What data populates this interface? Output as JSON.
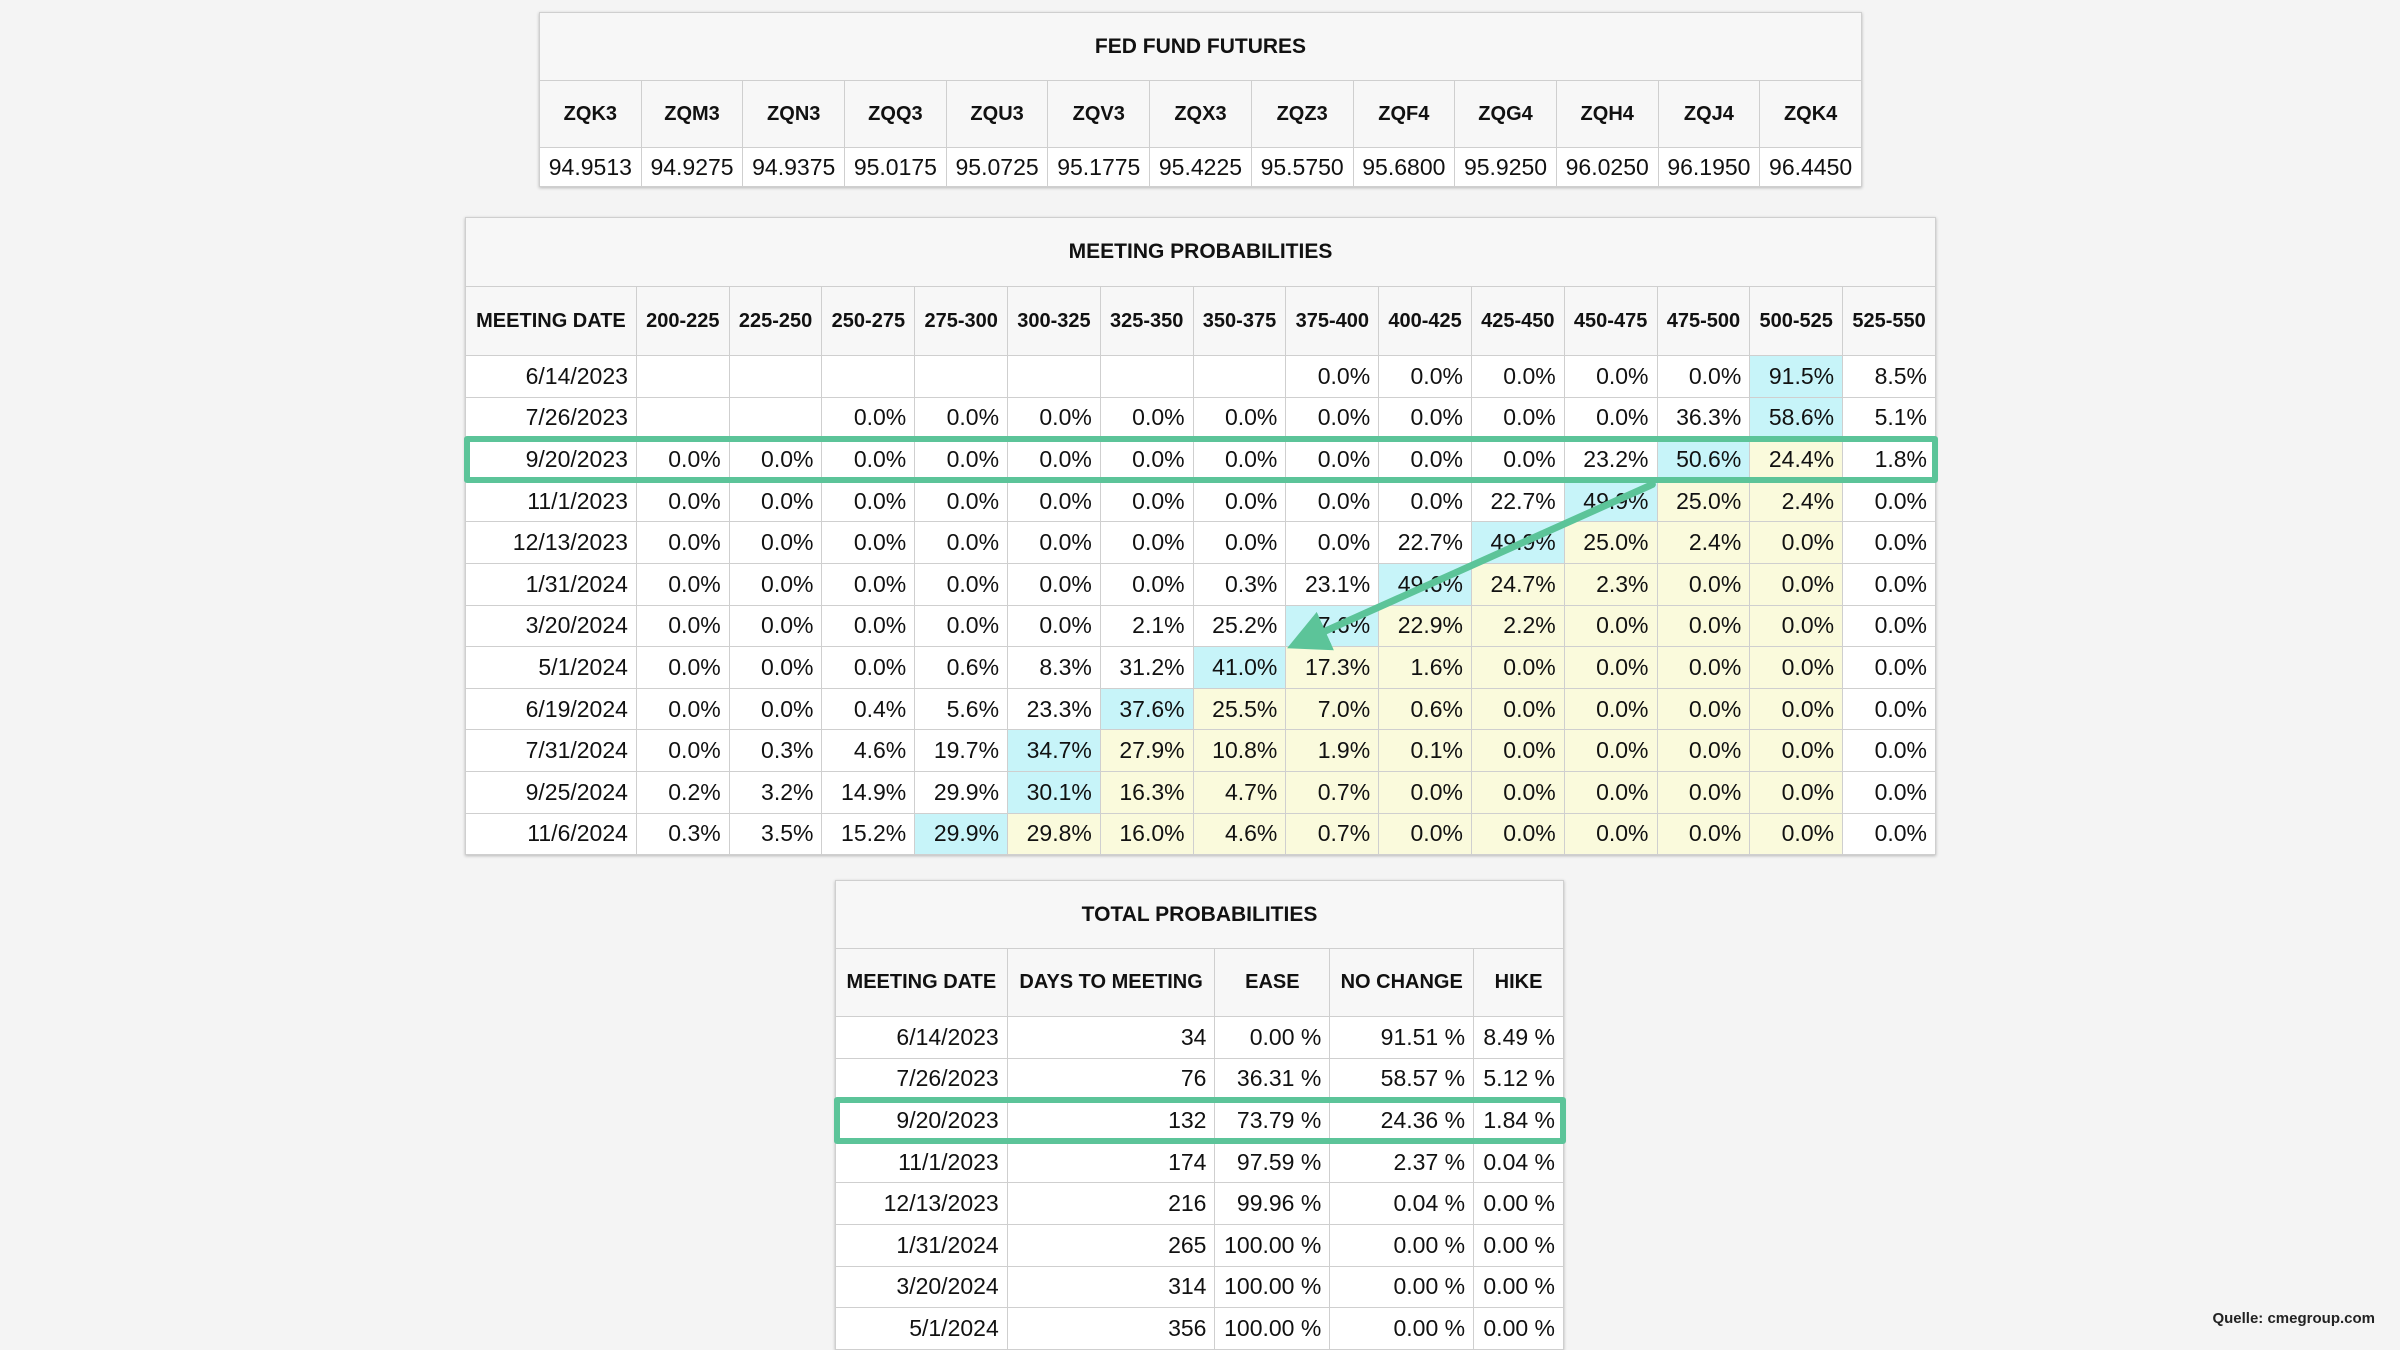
{
  "fed_fund_futures": {
    "title": "FED FUND FUTURES",
    "headers": [
      "ZQK3",
      "ZQM3",
      "ZQN3",
      "ZQQ3",
      "ZQU3",
      "ZQV3",
      "ZQX3",
      "ZQZ3",
      "ZQF4",
      "ZQG4",
      "ZQH4",
      "ZQJ4",
      "ZQK4"
    ],
    "values": [
      "94.9513",
      "94.9275",
      "94.9375",
      "95.0175",
      "95.0725",
      "95.1775",
      "95.4225",
      "95.5750",
      "95.6800",
      "95.9250",
      "96.0250",
      "96.1950",
      "96.4450"
    ]
  },
  "meeting_probabilities": {
    "title": "MEETING PROBABILITIES",
    "headers": [
      "MEETING DATE",
      "200-225",
      "225-250",
      "250-275",
      "275-300",
      "300-325",
      "325-350",
      "350-375",
      "375-400",
      "400-425",
      "425-450",
      "450-475",
      "475-500",
      "500-525",
      "525-550"
    ],
    "rows": [
      {
        "date": "6/14/2023",
        "cells": [
          "",
          "",
          "",
          "",
          "",
          "",
          "",
          "0.0%",
          "0.0%",
          "0.0%",
          "0.0%",
          "0.0%",
          "91.5%",
          "8.5%"
        ],
        "cyan": [
          12
        ],
        "yellow": []
      },
      {
        "date": "7/26/2023",
        "cells": [
          "",
          "",
          "0.0%",
          "0.0%",
          "0.0%",
          "0.0%",
          "0.0%",
          "0.0%",
          "0.0%",
          "0.0%",
          "0.0%",
          "36.3%",
          "58.6%",
          "5.1%"
        ],
        "cyan": [
          12
        ],
        "yellow": []
      },
      {
        "date": "9/20/2023",
        "cells": [
          "0.0%",
          "0.0%",
          "0.0%",
          "0.0%",
          "0.0%",
          "0.0%",
          "0.0%",
          "0.0%",
          "0.0%",
          "0.0%",
          "23.2%",
          "50.6%",
          "24.4%",
          "1.8%"
        ],
        "cyan": [
          11
        ],
        "yellow": [
          12
        ]
      },
      {
        "date": "11/1/2023",
        "cells": [
          "0.0%",
          "0.0%",
          "0.0%",
          "0.0%",
          "0.0%",
          "0.0%",
          "0.0%",
          "0.0%",
          "0.0%",
          "22.7%",
          "49.9%",
          "25.0%",
          "2.4%",
          "0.0%"
        ],
        "cyan": [
          10
        ],
        "yellow": [
          11,
          12
        ]
      },
      {
        "date": "12/13/2023",
        "cells": [
          "0.0%",
          "0.0%",
          "0.0%",
          "0.0%",
          "0.0%",
          "0.0%",
          "0.0%",
          "0.0%",
          "22.7%",
          "49.9%",
          "25.0%",
          "2.4%",
          "0.0%",
          "0.0%"
        ],
        "cyan": [
          9
        ],
        "yellow": [
          10,
          11,
          12
        ]
      },
      {
        "date": "1/31/2024",
        "cells": [
          "0.0%",
          "0.0%",
          "0.0%",
          "0.0%",
          "0.0%",
          "0.0%",
          "0.3%",
          "23.1%",
          "49.6%",
          "24.7%",
          "2.3%",
          "0.0%",
          "0.0%",
          "0.0%"
        ],
        "cyan": [
          8
        ],
        "yellow": [
          9,
          10,
          11,
          12
        ]
      },
      {
        "date": "3/20/2024",
        "cells": [
          "0.0%",
          "0.0%",
          "0.0%",
          "0.0%",
          "0.0%",
          "2.1%",
          "25.2%",
          "47.6%",
          "22.9%",
          "2.2%",
          "0.0%",
          "0.0%",
          "0.0%",
          "0.0%"
        ],
        "cyan": [
          7
        ],
        "yellow": [
          8,
          9,
          10,
          11,
          12
        ]
      },
      {
        "date": "5/1/2024",
        "cells": [
          "0.0%",
          "0.0%",
          "0.0%",
          "0.6%",
          "8.3%",
          "31.2%",
          "41.0%",
          "17.3%",
          "1.6%",
          "0.0%",
          "0.0%",
          "0.0%",
          "0.0%",
          "0.0%"
        ],
        "cyan": [
          6
        ],
        "yellow": [
          7,
          8,
          9,
          10,
          11,
          12
        ]
      },
      {
        "date": "6/19/2024",
        "cells": [
          "0.0%",
          "0.0%",
          "0.4%",
          "5.6%",
          "23.3%",
          "37.6%",
          "25.5%",
          "7.0%",
          "0.6%",
          "0.0%",
          "0.0%",
          "0.0%",
          "0.0%",
          "0.0%"
        ],
        "cyan": [
          5
        ],
        "yellow": [
          6,
          7,
          8,
          9,
          10,
          11,
          12
        ]
      },
      {
        "date": "7/31/2024",
        "cells": [
          "0.0%",
          "0.3%",
          "4.6%",
          "19.7%",
          "34.7%",
          "27.9%",
          "10.8%",
          "1.9%",
          "0.1%",
          "0.0%",
          "0.0%",
          "0.0%",
          "0.0%",
          "0.0%"
        ],
        "cyan": [
          4
        ],
        "yellow": [
          5,
          6,
          7,
          8,
          9,
          10,
          11,
          12
        ]
      },
      {
        "date": "9/25/2024",
        "cells": [
          "0.2%",
          "3.2%",
          "14.9%",
          "29.9%",
          "30.1%",
          "16.3%",
          "4.7%",
          "0.7%",
          "0.0%",
          "0.0%",
          "0.0%",
          "0.0%",
          "0.0%",
          "0.0%"
        ],
        "cyan": [
          4
        ],
        "yellow": [
          5,
          6,
          7,
          8,
          9,
          10,
          11,
          12
        ]
      },
      {
        "date": "11/6/2024",
        "cells": [
          "0.3%",
          "3.5%",
          "15.2%",
          "29.9%",
          "29.8%",
          "16.0%",
          "4.6%",
          "0.7%",
          "0.0%",
          "0.0%",
          "0.0%",
          "0.0%",
          "0.0%",
          "0.0%"
        ],
        "cyan": [
          3
        ],
        "yellow": [
          4,
          5,
          6,
          7,
          8,
          9,
          10,
          11,
          12
        ]
      }
    ],
    "highlighted_row": "9/20/2023"
  },
  "total_probabilities": {
    "title": "TOTAL PROBABILITIES",
    "headers": [
      "MEETING DATE",
      "DAYS TO MEETING",
      "EASE",
      "NO CHANGE",
      "HIKE"
    ],
    "rows": [
      [
        "6/14/2023",
        "34",
        "0.00 %",
        "91.51 %",
        "8.49 %"
      ],
      [
        "7/26/2023",
        "76",
        "36.31 %",
        "58.57 %",
        "5.12 %"
      ],
      [
        "9/20/2023",
        "132",
        "73.79 %",
        "24.36 %",
        "1.84 %"
      ],
      [
        "11/1/2023",
        "174",
        "97.59 %",
        "2.37 %",
        "0.04 %"
      ],
      [
        "12/13/2023",
        "216",
        "99.96 %",
        "0.04 %",
        "0.00 %"
      ],
      [
        "1/31/2024",
        "265",
        "100.00 %",
        "0.00 %",
        "0.00 %"
      ],
      [
        "3/20/2024",
        "314",
        "100.00 %",
        "0.00 %",
        "0.00 %"
      ],
      [
        "5/1/2024",
        "356",
        "100.00 %",
        "0.00 %",
        "0.00 %"
      ]
    ],
    "highlighted_row": "9/20/2023"
  },
  "source": "Quelle: cmegroup.com",
  "colors": {
    "highlight_green": "#5cc499",
    "cell_cyan": "#c7f4f9",
    "cell_yellow": "#fafadc"
  }
}
